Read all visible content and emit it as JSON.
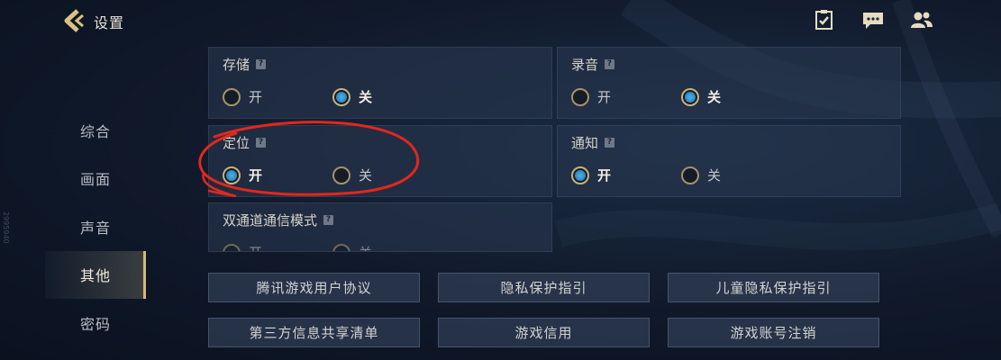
{
  "header": {
    "title": "设置",
    "icons": [
      "checklist-icon",
      "chat-icon",
      "friends-icon"
    ]
  },
  "sidebar": {
    "items": [
      {
        "label": "综合",
        "active": false
      },
      {
        "label": "画面",
        "active": false
      },
      {
        "label": "声音",
        "active": false
      },
      {
        "label": "其他",
        "active": true
      },
      {
        "label": "密码",
        "active": false
      }
    ]
  },
  "side_watermark": "2995940",
  "panels": {
    "storage": {
      "title": "存储",
      "on_label": "开",
      "off_label": "关",
      "selected": "off"
    },
    "recording": {
      "title": "录音",
      "on_label": "开",
      "off_label": "关",
      "selected": "off"
    },
    "location": {
      "title": "定位",
      "on_label": "开",
      "off_label": "关",
      "selected": "on"
    },
    "notification": {
      "title": "通知",
      "on_label": "开",
      "off_label": "关",
      "selected": "on"
    },
    "dual_channel": {
      "title": "双通道通信模式",
      "on_label": "开",
      "off_label": "关"
    }
  },
  "help_glyph": "?",
  "buttons": [
    "腾讯游戏用户协议",
    "隐私保护指引",
    "儿童隐私保护指引",
    "第三方信息共享清单",
    "游戏信用",
    "游戏账号注销"
  ],
  "colors": {
    "accent_gold": "#c9b27a",
    "radio_on": "#3a9ad6",
    "annotation_red": "#e0281e"
  }
}
